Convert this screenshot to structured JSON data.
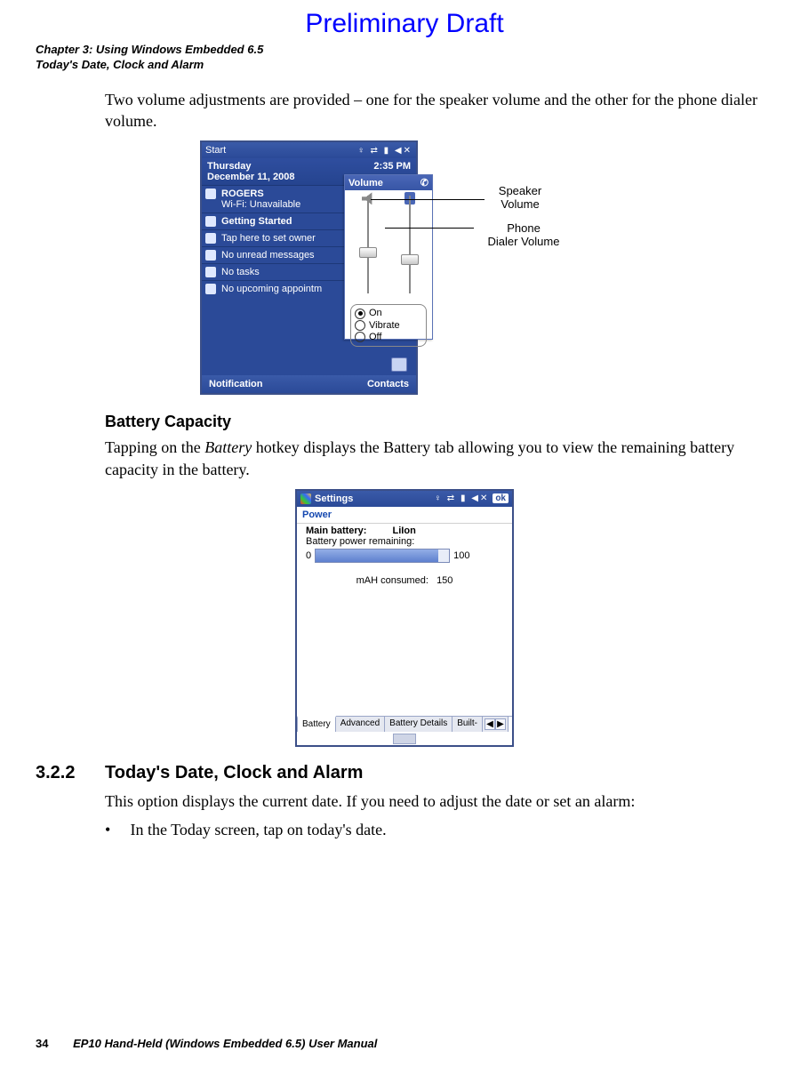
{
  "banner": "Preliminary Draft",
  "header": {
    "chapter": "Chapter 3:  Using Windows Embedded 6.5",
    "section": "Today's Date, Clock and Alarm"
  },
  "para_volume": "Two volume adjustments are provided – one for the speaker volume and the other for the phone dialer volume.",
  "fig1": {
    "topbar_start": "Start",
    "date_line1": "Thursday",
    "date_line2": "December 11, 2008",
    "time": "2:35 PM",
    "items": {
      "rogers": "ROGERS",
      "wifi": "Wi-Fi: Unavailable",
      "getting_started": "Getting Started",
      "owner": "Tap here to set owner",
      "messages": "No unread messages",
      "tasks": "No tasks",
      "appts": "No upcoming appointm"
    },
    "soft_left": "Notification",
    "soft_right": "Contacts",
    "vol_title": "Volume",
    "radios": {
      "on": "On",
      "vibrate": "Vibrate",
      "off": "Off"
    },
    "callout_speaker_l1": "Speaker",
    "callout_speaker_l2": "Volume",
    "callout_dialer_l1": "Phone",
    "callout_dialer_l2": "Dialer Volume"
  },
  "sub_battery": "Battery Capacity",
  "para_battery_pre": "Tapping on the ",
  "para_battery_em": "Battery",
  "para_battery_post": " hotkey displays the Battery tab allowing you to view the remaining battery capacity in the battery.",
  "fig2": {
    "topbar": "Settings",
    "ok": "ok",
    "panel": "Power",
    "mb_label": "Main battery:",
    "mb_type": "LiIon",
    "remaining": "Battery power remaining:",
    "p0": "0",
    "p100": "100",
    "mah_label": "mAH consumed:",
    "mah_value": "150",
    "tabs": {
      "battery": "Battery",
      "advanced": "Advanced",
      "details": "Battery Details",
      "builtin": "Built-"
    }
  },
  "section322_num": "3.2.2",
  "section322_title": "Today's Date, Clock and Alarm",
  "para_today": "This option displays the current date. If you need to adjust the date or set an alarm:",
  "bullet_pre": "In the ",
  "bullet_em": "Today",
  "bullet_mid": " screen, tap on ",
  "bullet_bold": "today's date",
  "bullet_end": ".",
  "footer": {
    "page": "34",
    "title": "EP10 Hand-Held (Windows Embedded 6.5) User Manual"
  }
}
